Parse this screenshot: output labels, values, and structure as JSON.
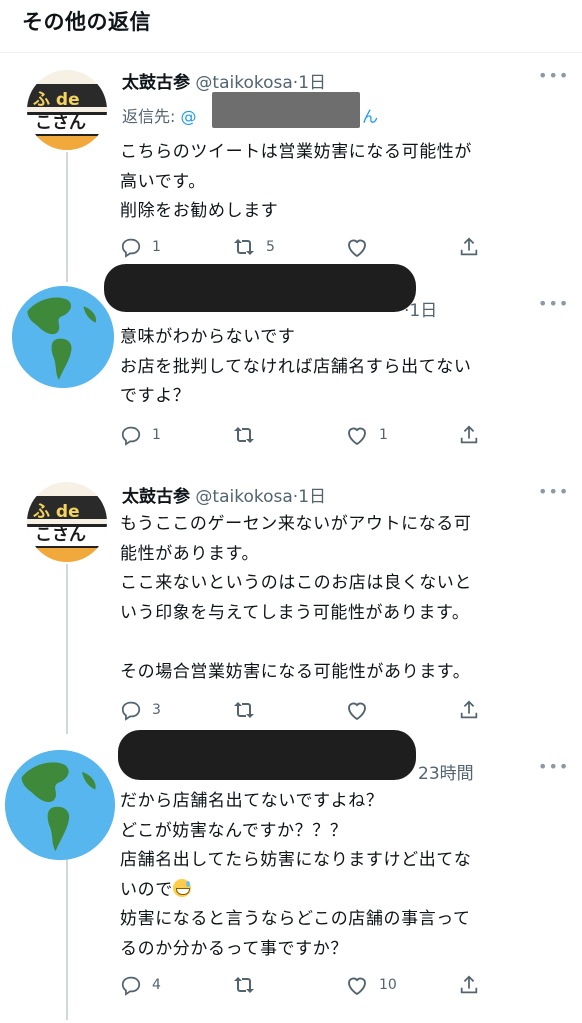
{
  "header": {
    "title": "その他の返信"
  },
  "tweets": [
    {
      "name": "太鼓古参",
      "handle": "@taikokosa",
      "time": "1日",
      "reply_label": "返信先: ",
      "reply_handle_start": "@",
      "reply_handle_end": "ん",
      "body": "こちらのツイートは営業妨害になる可能性が\n高いです。\n削除をお勧めします",
      "reply_count": "1",
      "retweet_count": "5",
      "like_count": "",
      "avatar_text_top": "ふ de",
      "avatar_text_bottom": "こさん"
    },
    {
      "time": "1日",
      "body": "意味がわからないです\nお店を批判してなければ店舗名すら出てない\nですよ？",
      "reply_count": "1",
      "retweet_count": "",
      "like_count": "1"
    },
    {
      "name": "太鼓古参",
      "handle": "@taikokosa",
      "time": "1日",
      "body": "もうここのゲーセン来ないがアウトになる可\n能性があります。\nここ来ないというのはこのお店は良くないと\nいう印象を与えてしまう可能性があります。\n\nその場合営業妨害になる可能性があります。",
      "reply_count": "3",
      "retweet_count": "",
      "like_count": "",
      "avatar_text_top": "ふ de",
      "avatar_text_bottom": "こさん"
    },
    {
      "time": "23時間",
      "body_1": "だから店舗名出てないですよね？\nどこが妨害なんですか？？？\n店舗名出してたら妨害になりますけど出てな\nいので",
      "body_2": "\n妨害になると言うならどこの店舗の事言って\nるのか分かるって事ですか？",
      "reply_count": "4",
      "retweet_count": "",
      "like_count": "10"
    }
  ],
  "icons": {
    "reply": "reply-icon",
    "retweet": "retweet-icon",
    "like": "heart-icon",
    "share": "share-icon",
    "more": "more-icon",
    "globe": "globe-avatar",
    "emoji": "sweat-smile-emoji"
  },
  "colors": {
    "link": "#1d9bf0",
    "secondary": "#536471",
    "text": "#0f1419"
  }
}
